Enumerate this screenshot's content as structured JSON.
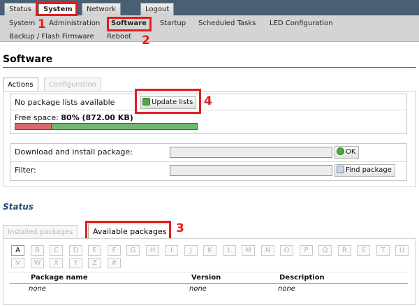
{
  "top_tabs": [
    "Status",
    "System",
    "Network",
    "Logout"
  ],
  "sub_nav": [
    "System",
    "Administration",
    "Software",
    "Startup",
    "Scheduled Tasks",
    "LED Configuration",
    "Backup / Flash Firmware",
    "Reboot"
  ],
  "annotations": [
    "1",
    "2",
    "3",
    "4"
  ],
  "page_title": "Software",
  "section_tabs": [
    "Actions",
    "Configuration"
  ],
  "actions": {
    "no_lists_text": "No package lists available",
    "update_lists_label": "Update lists",
    "free_space_label": "Free space:",
    "free_space_value": "80% (872.00 KB)",
    "free_space_fraction": 0.8,
    "download_label": "Download and install package:",
    "download_value": "",
    "ok_label": "OK",
    "filter_label": "Filter:",
    "filter_value": "",
    "find_label": "Find package"
  },
  "status": {
    "heading": "Status",
    "tabs": [
      "Installed packages",
      "Available packages"
    ],
    "letters": [
      "A",
      "B",
      "C",
      "D",
      "E",
      "F",
      "G",
      "H",
      "I",
      "J",
      "K",
      "L",
      "M",
      "N",
      "O",
      "P",
      "Q",
      "R",
      "S",
      "T",
      "U",
      "V",
      "W",
      "X",
      "Y",
      "Z",
      "#"
    ],
    "columns": [
      "Package name",
      "Version",
      "Description"
    ],
    "row": [
      "none",
      "none",
      "none"
    ]
  },
  "colors": {
    "annotation": "#e31d1d",
    "header_bar": "#4a5f72",
    "used_space": "#d96a6a",
    "free_space": "#72b672"
  }
}
